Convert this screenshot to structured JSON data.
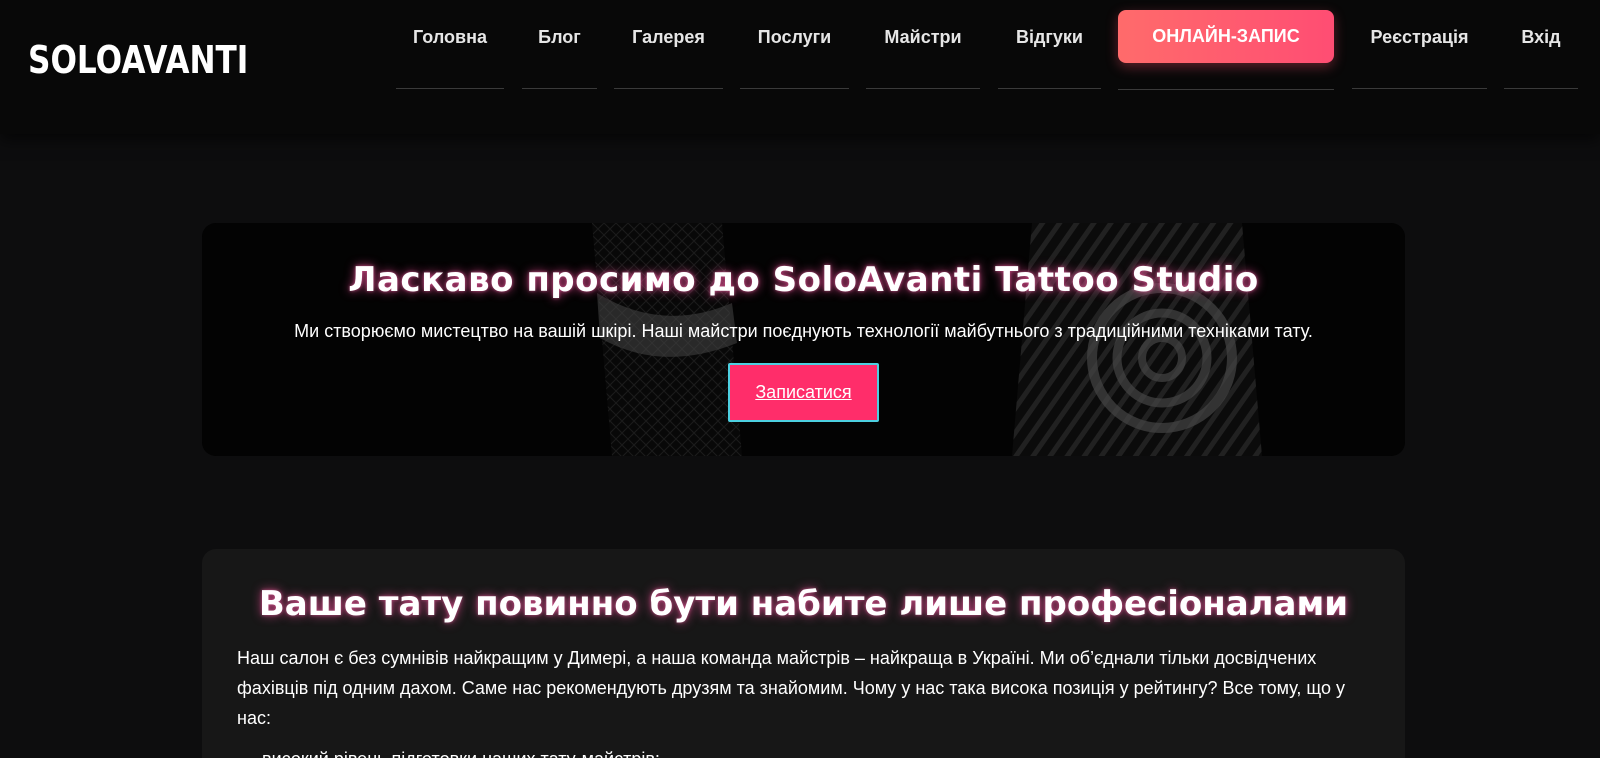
{
  "header": {
    "logo": "SOLOAVANTI",
    "nav": [
      {
        "label": "Головна"
      },
      {
        "label": "Блог"
      },
      {
        "label": "Галерея"
      },
      {
        "label": "Послуги"
      },
      {
        "label": "Майстри"
      },
      {
        "label": "Відгуки"
      }
    ],
    "cta_label": "ОНЛАЙН-ЗАПИС",
    "register_label": "Реєстрація",
    "login_label": "Вхід"
  },
  "hero": {
    "title": "Ласкаво просимо до SoloAvanti Tattoo Studio",
    "subtitle": "Ми створюємо мистецтво на вашій шкірі. Наші майстри поєднують технології майбутнього з традиційними техніками тату.",
    "button_label": "Записатися"
  },
  "about": {
    "title": "Ваше тату повинно бути набите лише професіоналами",
    "text": "Наш салон є без сумнівів найкращим у Димері, а наша команда майстрів – найкраща в Україні. Ми об’єднали тільки досвідчених фахівців під одним дахом. Саме нас рекомендують друзям та знайомим. Чому у нас така висока позиція у рейтингу? Все тому, що у нас:",
    "list": [
      "високий рівень підготовки наших тату-майстрів;"
    ]
  },
  "colors": {
    "background": "#0d0d0e",
    "header": "#080808",
    "cta_gradient_start": "#ff6b6b",
    "cta_gradient_end": "#ff4d73",
    "hero_button": "#ff2d6a",
    "hero_button_border": "#4dd0e1",
    "section_bg": "#171717"
  }
}
